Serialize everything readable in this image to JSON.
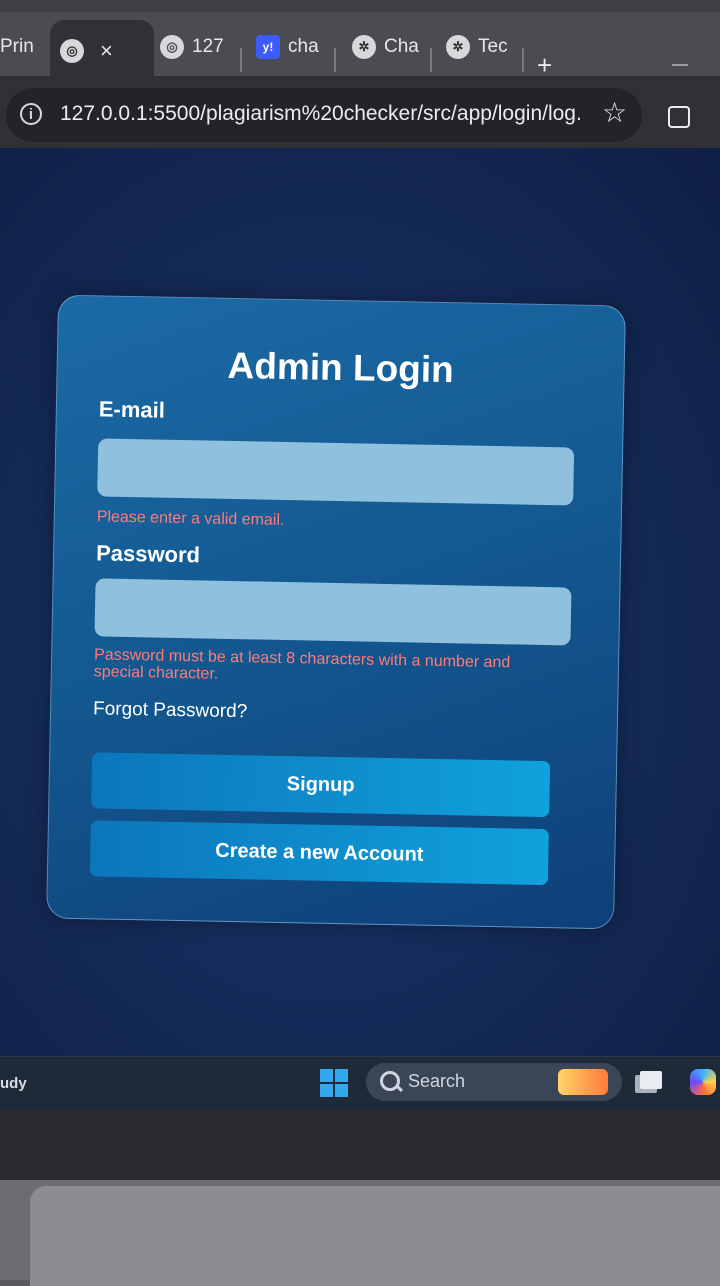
{
  "browser": {
    "tabs": [
      {
        "label": "Prin",
        "icon": "page-icon"
      },
      {
        "label": "",
        "icon": "globe-icon",
        "close": "×"
      },
      {
        "label": "127",
        "icon": "globe-icon"
      },
      {
        "label": "cha",
        "icon": "yahoo-icon",
        "icon_text": "y!"
      },
      {
        "label": "Cha",
        "icon": "chatgpt-icon"
      },
      {
        "label": "Tec",
        "icon": "chatgpt-icon"
      }
    ],
    "new_tab": "+",
    "url": "127.0.0.1:5500/plagiarism%20checker/src/app/login/log...",
    "star": "☆"
  },
  "login": {
    "title": "Admin Login",
    "email_label": "E-mail",
    "email_value": "",
    "email_error": "Please enter a valid email.",
    "password_label": "Password",
    "password_value": "",
    "password_error": "Password must be at least 8 characters with a number and special character.",
    "forgot": "Forgot Password?",
    "signup_button": "Signup",
    "create_button": "Create a new Account"
  },
  "taskbar": {
    "left_text": "udy",
    "search_label": "Search"
  },
  "colors": {
    "page_bg": "#142a57",
    "card_bg": "#145a92",
    "input_bg": "#8fc0de",
    "error": "#ff7a7a",
    "button": "#10a2dc"
  }
}
